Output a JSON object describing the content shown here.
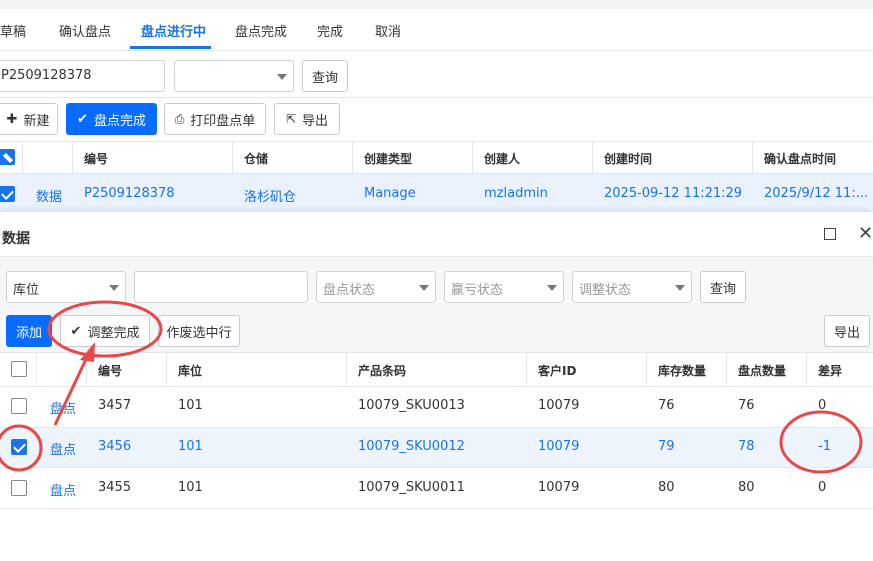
{
  "tabs": [
    "草稿",
    "确认盘点",
    "盘点进行中",
    "盘点完成",
    "完成",
    "取消"
  ],
  "top_search": {
    "value": "P2509128378",
    "select_value": "",
    "query_label": "查询"
  },
  "top_toolbar": {
    "new_label": "新建",
    "complete_label": "盘点完成",
    "print_label": "打印盘点单",
    "export_label": "导出"
  },
  "top_table": {
    "headers": [
      "编号",
      "仓储",
      "创建类型",
      "创建人",
      "创建时间",
      "确认盘点时间"
    ],
    "row": {
      "action": "数据",
      "cells": [
        "P2509128378",
        "洛杉矶仓",
        "Manage",
        "mzladmin",
        "2025-09-12 11:21:29",
        "2025/9/12 11:..."
      ]
    }
  },
  "dialog": {
    "title": "数据",
    "filters": {
      "location": "库位",
      "text": "",
      "count_status": "盘点状态",
      "profit_status": "赢亏状态",
      "adjust_status": "调整状态",
      "query_label": "查询"
    },
    "toolbar": {
      "add_label": "添加",
      "adjust_done_label": "调整完成",
      "void_label": "作废选中行",
      "export_label": "导出"
    },
    "headers": [
      "编号",
      "库位",
      "产品条码",
      "客户ID",
      "库存数量",
      "盘点数量",
      "差异"
    ],
    "rows": [
      {
        "action": "盘点",
        "cells": [
          "3457",
          "101",
          "10079_SKU0013",
          "10079",
          "76",
          "76",
          "0"
        ],
        "checked": false
      },
      {
        "action": "盘点",
        "cells": [
          "3456",
          "101",
          "10079_SKU0012",
          "10079",
          "79",
          "78",
          "-1"
        ],
        "checked": true
      },
      {
        "action": "盘点",
        "cells": [
          "3455",
          "101",
          "10079_SKU0011",
          "10079",
          "80",
          "80",
          "0"
        ],
        "checked": false
      }
    ]
  },
  "annotation_color": "#e84848"
}
